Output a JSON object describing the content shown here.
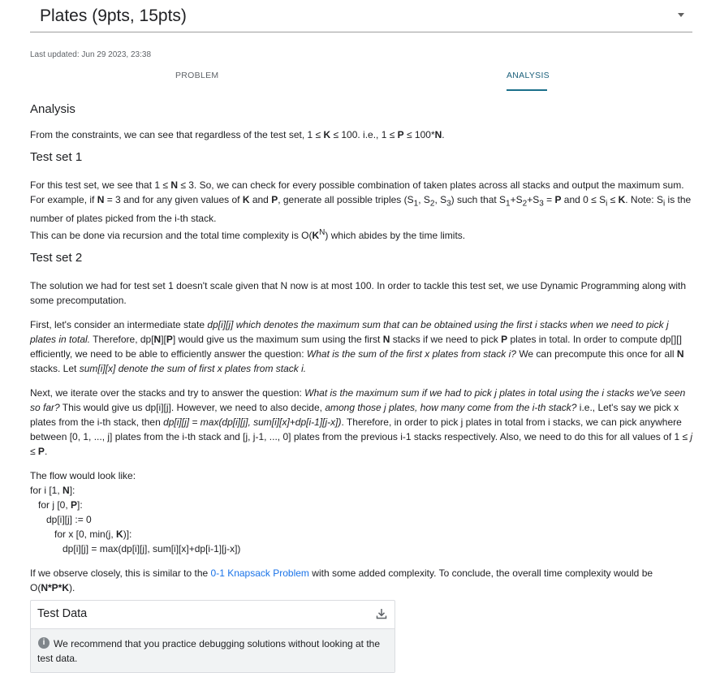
{
  "header": {
    "title": "Plates (9pts, 15pts)"
  },
  "meta": {
    "last_updated": "Last updated: Jun 29 2023, 23:38"
  },
  "tabs": {
    "problem": "PROBLEM",
    "analysis": "ANALYSIS"
  },
  "icons": {
    "dropdown": "chevron-down-icon",
    "download": "download-icon",
    "info": "info-icon"
  },
  "colors": {
    "accent": "#1a6f8a",
    "link": "#1a73e8"
  },
  "content": {
    "analysis_heading": "Analysis",
    "constraints": {
      "a": "From the constraints, we can see that regardless of the test set, 1 ≤ ",
      "b": "K",
      "c": " ≤ 100. i.e., 1 ≤ ",
      "d": "P",
      "e": " ≤ 100*",
      "f": "N",
      "g": "."
    },
    "ts1_heading": "Test set 1",
    "ts1": {
      "a": "For this test set, we see that 1 ≤ ",
      "b": "N",
      "c": " ≤ 3. So, we can check for every possible combination of taken plates across all stacks and output the maximum sum. For example, if ",
      "d": "N",
      "e": " = 3 and for any given values of ",
      "f": "K",
      "g": " and ",
      "h": "P",
      "i": ", generate all possible triples (S",
      "s1": "1",
      "j": ", S",
      "s2": "2",
      "k": ", S",
      "s3": "3",
      "l": ") such that S",
      "s4": "1",
      "m": "+S",
      "s5": "2",
      "n": "+S",
      "s6": "3",
      "o": " = ",
      "p": "P",
      "q": " and 0 ≤ S",
      "si": "i",
      "r": " ≤ ",
      "s": "K",
      "t": ". Note: S",
      "si2": "i",
      "u": " is the number of plates picked from the i-th stack.",
      "v": "This can be done via recursion and the total time complexity is O(",
      "w": "K",
      "sup": "N",
      "x": ") which abides by the time limits."
    },
    "ts2_heading": "Test set 2",
    "ts2_p1": "The solution we had for test set 1 doesn't scale given that N now is at most 100. In order to tackle this test set, we use Dynamic Programming along with some precomputation.",
    "ts2_p2": {
      "a": "First, let's consider an intermediate state ",
      "b": "dp[i][j] which denotes the maximum sum that can be obtained using the first i stacks when we need to pick j plates in total.",
      "c": " Therefore, dp[",
      "d": "N",
      "e": "][",
      "f": "P",
      "g": "] would give us the maximum sum using the first ",
      "h": "N",
      "i": " stacks if we need to pick ",
      "j": "P",
      "k": " plates in total. In order to compute dp[][] efficiently, we need to be able to efficiently answer the question: ",
      "l": "What is the sum of the first x plates from stack i?",
      "m": " We can precompute this once for all ",
      "n": "N",
      "o": " stacks. Let ",
      "p": "sum[i][x] denote the sum of first x plates from stack i."
    },
    "ts2_p3": {
      "a": "Next, we iterate over the stacks and try to answer the question: ",
      "b": "What is the maximum sum if we had to pick j plates in total using the i stacks we've seen so far?",
      "c": " This would give us dp[i][j]. However, we need to also decide, ",
      "d": "among those j plates, how many come from the i-th stack?",
      "e": " i.e., Let's say we pick x plates from the i-th stack, then ",
      "f": "dp[i][j] = max(dp[i][j], sum[i][x]+dp[i-1][j-x])",
      "g": ". Therefore, in order to pick j plates in total from i stacks, we can pick anywhere between [0, 1, ..., j] plates from the i-th stack and [j, j-1, ..., 0] plates from the previous i-1 stacks respectively. Also, we need to do this for all values of 1 ≤ ",
      "h": "j",
      "i": " ≤ ",
      "j": "P",
      "k": "."
    },
    "code": {
      "intro": "The flow would look like:",
      "l1a": "for i [1, ",
      "l1b": "N",
      "l1c": "]:",
      "l2a": "   for j [0, ",
      "l2b": "P",
      "l2c": "]:",
      "l3": "      dp[i][j] := 0",
      "l4a": "         for x [0, min(j, ",
      "l4b": "K",
      "l4c": ")]:",
      "l5": "            dp[i][j] = max(dp[i][j], sum[i][x]+dp[i-1][j-x])"
    },
    "conclusion": {
      "a": "If we observe closely, this is similar to the ",
      "link": "0-1 Knapsack Problem",
      "b": " with some added complexity. To conclude, the overall time complexity would be O(",
      "c": "N*P*K",
      "d": ")."
    }
  },
  "test_data": {
    "title": "Test Data",
    "notice": "We recommend that you practice debugging solutions without looking at the test data."
  }
}
